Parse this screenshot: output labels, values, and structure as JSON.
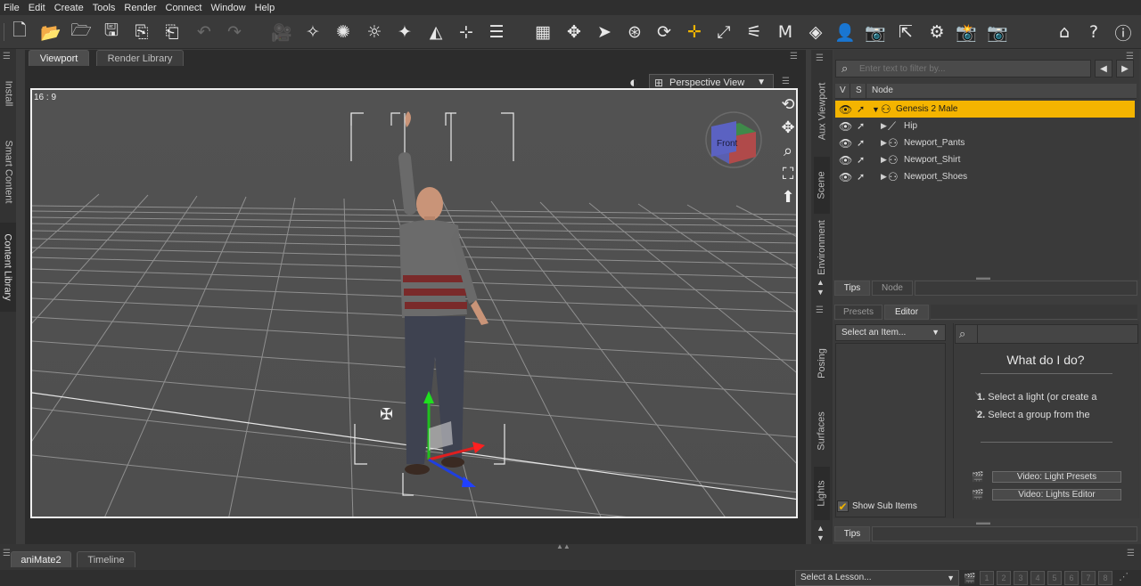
{
  "menu": [
    "File",
    "Edit",
    "Create",
    "Tools",
    "Render",
    "Connect",
    "Window",
    "Help"
  ],
  "viewport_tabs": [
    "Viewport",
    "Render Library"
  ],
  "left_tabs": [
    "Install",
    "Smart Content",
    "Content Library"
  ],
  "viewport": {
    "aspect_label": "16 : 9",
    "view_label": "Perspective View",
    "cube_label": "Front"
  },
  "mid_tabs": [
    "Aux Viewport",
    "Scene",
    "Environment",
    "Posing",
    "Surfaces",
    "Lights"
  ],
  "scene": {
    "filter_placeholder": "Enter text to filter by...",
    "headers": [
      "V",
      "S",
      "Node"
    ],
    "nodes": [
      {
        "label": "Genesis 2 Male",
        "selected": true
      },
      {
        "label": "Hip",
        "selected": false
      },
      {
        "label": "Newport_Pants",
        "selected": false
      },
      {
        "label": "Newport_Shirt",
        "selected": false
      },
      {
        "label": "Newport_Shoes",
        "selected": false
      }
    ],
    "bottom_tabs": [
      "Tips",
      "Node"
    ]
  },
  "lights": {
    "tabs": [
      "Presets",
      "Editor"
    ],
    "select_item": "Select an Item...",
    "show_sub_items": "Show Sub Items",
    "what_do": "What do I do?",
    "steps": [
      {
        "num": "1.",
        "text": "Select a light (or create a"
      },
      {
        "num": "2.",
        "text": "Select a group from the"
      }
    ],
    "video_buttons": [
      "Video: Light Presets",
      "Video: Lights Editor"
    ],
    "bottom_tab": "Tips"
  },
  "bottom_tabs": [
    "aniMate2",
    "Timeline"
  ],
  "status": {
    "lesson": "Select a Lesson...",
    "pages": [
      "1",
      "2",
      "3",
      "4",
      "5",
      "6",
      "7",
      "8"
    ]
  }
}
